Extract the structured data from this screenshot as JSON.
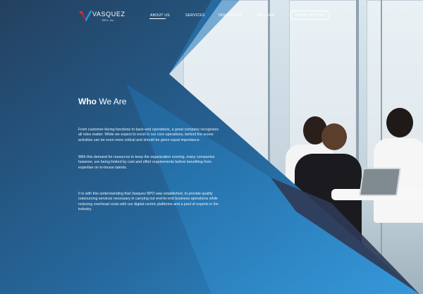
{
  "brand": {
    "name": "VASQUEZ",
    "sub": "BPO, Inc."
  },
  "nav": {
    "items": [
      "ABOUT US",
      "SERVICES",
      "INDUSTRIES",
      "THE TEAM"
    ],
    "cta": "WORK WITH US",
    "active_index": 0
  },
  "section": {
    "title_bold": "Who",
    "title_rest": "We Are",
    "paragraphs": [
      "From customer-facing functions to back-end operations, a great company recognizes all roles matter. While we expect to excel in our core operations, behind the scene activities can be even more critical and should be given equal importance.",
      "With this demand for resources to keep the organization running, many companies however, are being limited by cost and effort requirements before benefiting from expertise on in-house talents.",
      "It is with this understanding that Vasquez BPO was established, to provide quality outsourcing services necessary in carrying out end-to-end business operations while reducing overhead costs with our digital-centric platforms and a pool of experts in the industry."
    ]
  },
  "colors": {
    "primary_blue": "#2c86c8",
    "dark_navy": "#25324a",
    "logo_red": "#e0343c",
    "logo_blue": "#2a8fd0"
  }
}
